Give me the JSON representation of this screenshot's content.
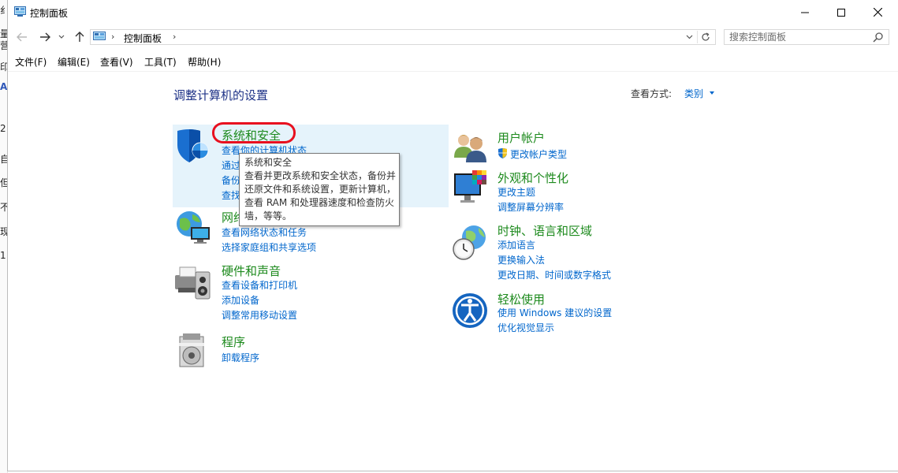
{
  "background_window": {
    "fragments": [
      "纟",
      "量",
      "营",
      "印",
      "A",
      "2",
      "自",
      "但",
      "不",
      "现",
      "1"
    ]
  },
  "window": {
    "title": "控制面板",
    "controls": {
      "minimize": "minimize-icon",
      "maximize": "maximize-icon",
      "close": "close-icon"
    }
  },
  "address_bar": {
    "breadcrumb": "控制面板",
    "search_placeholder": "搜索控制面板"
  },
  "menu": [
    {
      "label": "文件(F)"
    },
    {
      "label": "编辑(E)"
    },
    {
      "label": "查看(V)"
    },
    {
      "label": "工具(T)"
    },
    {
      "label": "帮助(H)"
    }
  ],
  "main": {
    "title": "调整计算机的设置",
    "view_by_label": "查看方式:",
    "view_by_value": "类别"
  },
  "categories": {
    "system_security": {
      "title": "系统和安全",
      "links": [
        "查看你的计算机状态",
        "通过",
        "备份",
        "查找"
      ]
    },
    "network": {
      "title": "网络",
      "links": [
        "查看网络状态和任务",
        "选择家庭组和共享选项"
      ]
    },
    "hardware_sound": {
      "title": "硬件和声音",
      "links": [
        "查看设备和打印机",
        "添加设备",
        "调整常用移动设置"
      ]
    },
    "programs": {
      "title": "程序",
      "links": [
        "卸载程序"
      ]
    },
    "user_accounts": {
      "title": "用户帐户",
      "links": [
        "更改帐户类型"
      ]
    },
    "appearance": {
      "title": "外观和个性化",
      "links": [
        "更改主题",
        "调整屏幕分辨率"
      ]
    },
    "clock_region": {
      "title": "时钟、语言和区域",
      "links": [
        "添加语言",
        "更换输入法",
        "更改日期、时间或数字格式"
      ]
    },
    "ease_of_access": {
      "title": "轻松使用",
      "links": [
        "使用 Windows 建议的设置",
        "优化视觉显示"
      ]
    }
  },
  "tooltip": {
    "lines": [
      "系统和安全",
      "查看并更改系统和安全状态，备份并",
      "还原文件和系统设置，更新计算机，",
      "查看 RAM 和处理器速度和检查防火",
      "墙，等等。"
    ]
  },
  "colors": {
    "category_title": "#1d8a1d",
    "link": "#0066cc",
    "main_title": "#1e3287",
    "hover": "#e5f3fb",
    "highlight": "#e8101f"
  }
}
